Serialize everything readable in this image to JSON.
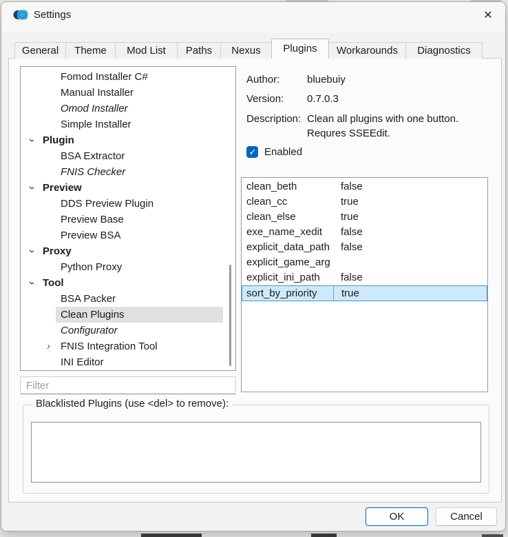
{
  "window": {
    "title": "Settings",
    "close_glyph": "✕"
  },
  "tabs": [
    {
      "label": "General"
    },
    {
      "label": "Theme"
    },
    {
      "label": "Mod List"
    },
    {
      "label": "Paths"
    },
    {
      "label": "Nexus"
    },
    {
      "label": "Plugins",
      "active": true
    },
    {
      "label": "Workarounds"
    },
    {
      "label": "Diagnostics"
    }
  ],
  "tree": {
    "filter_placeholder": "Filter",
    "items": [
      {
        "label": "Fomod Installer C#",
        "level": 2
      },
      {
        "label": "Manual Installer",
        "level": 2
      },
      {
        "label": "Omod Installer",
        "level": 2,
        "italic": true
      },
      {
        "label": "Simple Installer",
        "level": 2
      },
      {
        "label": "Plugin",
        "level": 1,
        "bold": true,
        "expanded": true
      },
      {
        "label": "BSA Extractor",
        "level": 2
      },
      {
        "label": "FNIS Checker",
        "level": 2,
        "italic": true
      },
      {
        "label": "Preview",
        "level": 1,
        "bold": true,
        "expanded": true
      },
      {
        "label": "DDS Preview Plugin",
        "level": 2
      },
      {
        "label": "Preview Base",
        "level": 2
      },
      {
        "label": "Preview BSA",
        "level": 2
      },
      {
        "label": "Proxy",
        "level": 1,
        "bold": true,
        "expanded": true
      },
      {
        "label": "Python Proxy",
        "level": 2
      },
      {
        "label": "Tool",
        "level": 1,
        "bold": true,
        "expanded": true
      },
      {
        "label": "BSA Packer",
        "level": 2
      },
      {
        "label": "Clean Plugins",
        "level": 2,
        "selected": true
      },
      {
        "label": "Configurator",
        "level": 2,
        "italic": true
      },
      {
        "label": "FNIS Integration Tool",
        "level": 2,
        "collapsed": true
      },
      {
        "label": "INI Editor",
        "level": 2
      }
    ]
  },
  "details": {
    "author_label": "Author:",
    "author": "bluebuiy",
    "version_label": "Version:",
    "version": "0.7.0.3",
    "description_label": "Description:",
    "description_line1": "Clean all plugins with one button.",
    "description_line2": "Requres SSEEdit.",
    "enabled_label": "Enabled",
    "enabled_checked": true
  },
  "settings_table": {
    "rows": [
      {
        "key": "clean_beth",
        "value": "false"
      },
      {
        "key": "clean_cc",
        "value": "true"
      },
      {
        "key": "clean_else",
        "value": "true"
      },
      {
        "key": "exe_name_xedit",
        "value": "false"
      },
      {
        "key": "explicit_data_path",
        "value": "false"
      },
      {
        "key": "explicit_game_arg",
        "value": ""
      },
      {
        "key": "explicit_ini_path",
        "value": "false"
      },
      {
        "key": "sort_by_priority",
        "value": "true",
        "selected": true
      }
    ]
  },
  "blacklist": {
    "group_label": "Blacklisted Plugins (use <del> to remove):"
  },
  "footer": {
    "ok_label": "OK",
    "cancel_label": "Cancel"
  },
  "colors": {
    "accent": "#0067c0",
    "selection_fill": "#cfe9fc",
    "selection_border": "#4795cf"
  }
}
